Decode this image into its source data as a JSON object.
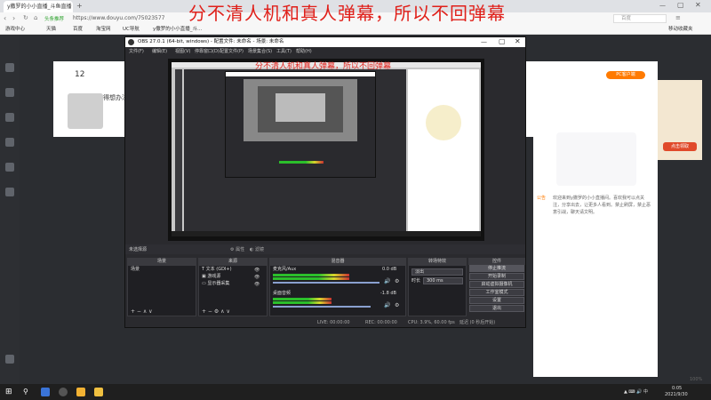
{
  "browser": {
    "tab_label": "y撒罗的小小直播_斗鱼直播",
    "url": "https://www.douyu.com/75023577",
    "url_badge": "头条推荐",
    "search_placeholder": "百度",
    "bookmarks": [
      "游戏中心",
      "天猫",
      "百度",
      "淘宝网",
      "UC导航",
      "y撒罗的小小直播_斗..."
    ],
    "bookmarks_other": "移动收藏夹"
  },
  "overlay": {
    "title": "分不清人机和真人弹幕，所以不回弹幕",
    "title_small": "分不清人机和真人弹幕，所以不回弹幕"
  },
  "page": {
    "streamer_name": "得想办法",
    "follow_count": "12",
    "badge": "PC客户端",
    "notice_label": "公告",
    "notice_text": "欢迎来到y撒罗的小小直播间。喜欢我可以点关注，分享出去，让更多人看到。禁止刷屏，禁止恶意引战，聊天请文明。",
    "ad_label": "点击领取"
  },
  "obs": {
    "window_title": "OBS 27.0.1 (64-bit, windows) - 配置文件: 未命名 - 场景: 未命名",
    "menus": [
      "文件(F)",
      "编辑(E)",
      "视图(V)",
      "停靠窗口(D)",
      "配置文件(P)",
      "场景集合(S)",
      "工具(T)",
      "帮助(H)"
    ],
    "no_source_selected": "未选择源",
    "properties": "属性",
    "filters": "滤镜",
    "docks": {
      "scenes_title": "场景",
      "sources_title": "来源",
      "mixer_title": "混音器",
      "transitions_title": "转场特效",
      "controls_title": "控件"
    },
    "scene_items": [
      "场景"
    ],
    "source_items": [
      "文本 (GDI+)",
      "游戏源",
      "显示器采集"
    ],
    "mixer": {
      "track1_name": "麦克风/Aux",
      "track1_db": "0.0 dB",
      "track2_name": "桌面音频",
      "track2_db": "-1.8 dB",
      "track1_level": 0.72,
      "track2_level": 0.55
    },
    "transitions": {
      "type": "淡出",
      "duration_label": "时长",
      "duration": "300 ms"
    },
    "controls": [
      "停止推流",
      "开始录制",
      "启动虚拟摄像机",
      "工作室模式",
      "设置",
      "退出"
    ],
    "status": {
      "live": "LIVE: 00:00:00",
      "rec": "REC: 00:00:00",
      "cpu": "CPU: 3.9%, 60.00 fps",
      "right": "延迟 (0 秒后开始)"
    }
  },
  "taskbar": {
    "time": "0:05",
    "date": "2021/9/30",
    "zoom": "100%"
  },
  "colors": {
    "overlay_red": "#e0201a",
    "obs_bg": "#2a2a2e",
    "accent_orange": "#ff7a00"
  }
}
